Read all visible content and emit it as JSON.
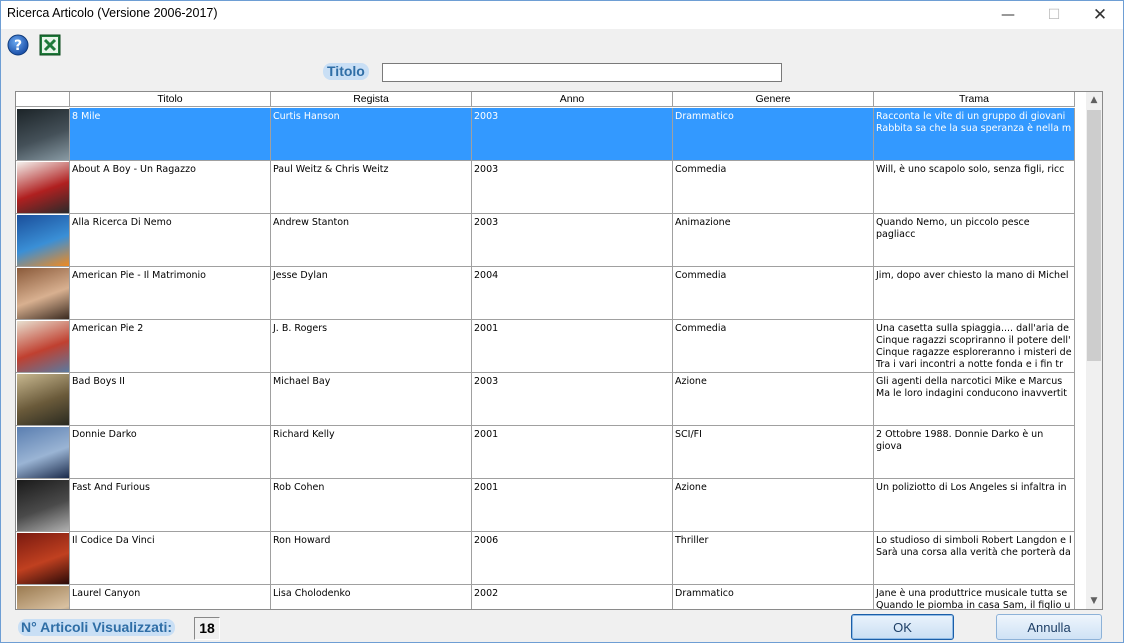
{
  "window": {
    "title": "Ricerca Articolo (Versione 2006-2017)"
  },
  "titlebar_buttons": {
    "minimize": "—",
    "maximize": "☐",
    "close": "✕"
  },
  "search": {
    "label": "Titolo",
    "value": ""
  },
  "table": {
    "headers": {
      "poster": "",
      "titolo": "Titolo",
      "regista": "Regista",
      "anno": "Anno",
      "genere": "Genere",
      "trama": "Trama"
    },
    "rows": [
      {
        "titolo": "8 Mile",
        "regista": "Curtis Hanson",
        "anno": "2003",
        "genere": "Drammatico",
        "trama": "Racconta le vite di un gruppo di giovani\nRabbita sa che la sua speranza è nella m",
        "selected": true,
        "poster_colors": [
          "#1c2428",
          "#445058",
          "#889aa4"
        ]
      },
      {
        "titolo": "About A Boy - Un Ragazzo",
        "regista": "Paul Weitz & Chris Weitz",
        "anno": "2003",
        "genere": "Commedia",
        "trama": "Will, è uno scapolo solo, senza figli, ricc",
        "poster_colors": [
          "#f3f0ec",
          "#b02020",
          "#2a2a2a"
        ]
      },
      {
        "titolo": "Alla Ricerca Di Nemo",
        "regista": "Andrew Stanton",
        "anno": "2003",
        "genere": "Animazione",
        "trama": "Quando Nemo, un piccolo pesce pagliacc",
        "poster_colors": [
          "#1a4e9a",
          "#3a8fd6",
          "#f08a20"
        ]
      },
      {
        "titolo": "American Pie - Il Matrimonio",
        "regista": "Jesse Dylan",
        "anno": "2004",
        "genere": "Commedia",
        "trama": "Jim, dopo aver chiesto la mano di Michel",
        "poster_colors": [
          "#8a5a3a",
          "#d8b090",
          "#3a2a20"
        ]
      },
      {
        "titolo": "American Pie 2",
        "regista": "J. B. Rogers",
        "anno": "2001",
        "genere": "Commedia",
        "trama": "Una casetta sulla spiaggia.... dall'aria de\nCinque ragazzi scopriranno il potere dell'\nCinque ragazze esploreranno i misteri de\nTra i vari incontri a notte fonda e i fin tr",
        "poster_colors": [
          "#e8e0d0",
          "#c04030",
          "#5a7aa0"
        ]
      },
      {
        "titolo": "Bad Boys II",
        "regista": "Michael Bay",
        "anno": "2003",
        "genere": "Azione",
        "trama": "Gli agenti della narcotici Mike e Marcus\nMa le loro indagini conducono inavvertit",
        "poster_colors": [
          "#c8b890",
          "#6a5a3a",
          "#2a2a20"
        ]
      },
      {
        "titolo": "Donnie Darko",
        "regista": "Richard Kelly",
        "anno": "2001",
        "genere": "SCI/FI",
        "trama": "2 Ottobre 1988. Donnie Darko è un giova",
        "poster_colors": [
          "#5a7eb0",
          "#9ab4d4",
          "#1a2a4a"
        ]
      },
      {
        "titolo": "Fast And Furious",
        "regista": "Rob Cohen",
        "anno": "2001",
        "genere": "Azione",
        "trama": "Un poliziotto di Los Angeles si infaltra in",
        "poster_colors": [
          "#1a1a1a",
          "#4a4a4a",
          "#b0b0b0"
        ]
      },
      {
        "titolo": "Il Codice Da Vinci",
        "regista": "Ron Howard",
        "anno": "2006",
        "genere": "Thriller",
        "trama": "Lo studioso di simboli Robert Langdon e l\nSarà una corsa alla verità che porterà da",
        "poster_colors": [
          "#7a1a10",
          "#c04020",
          "#2a0a08"
        ]
      },
      {
        "titolo": "Laurel Canyon",
        "regista": "Lisa Cholodenko",
        "anno": "2002",
        "genere": "Drammatico",
        "trama": "Jane è una produttrice musicale tutta se\nQuando le piomba in casa Sam, il figlio u",
        "poster_colors": [
          "#9a7a50",
          "#d8c0a0",
          "#4a3a2a"
        ]
      }
    ]
  },
  "scrollbar": {
    "up": "▲",
    "down": "▼"
  },
  "footer": {
    "count_label": "N° Articoli Visualizzati:",
    "count_value": "18",
    "ok_label": "OK",
    "cancel_label": "Annulla"
  }
}
